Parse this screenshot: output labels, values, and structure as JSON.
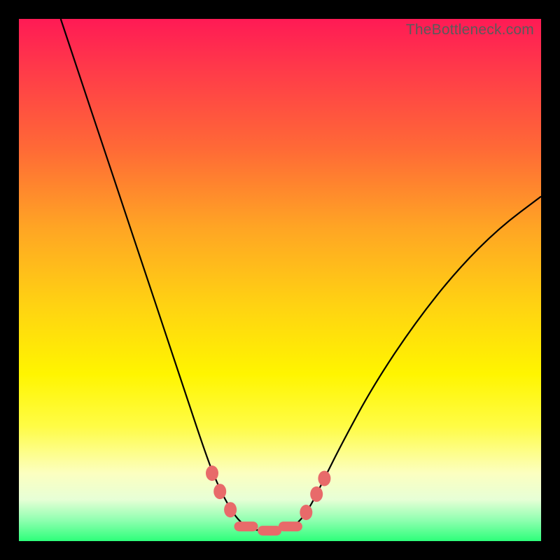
{
  "watermark": "TheBottleneck.com",
  "colors": {
    "frame_bg": "#000000",
    "curve_stroke": "#000000",
    "marker_fill": "#e86a6a",
    "gradient_top": "#ff1a55",
    "gradient_bottom": "#2dff7a"
  },
  "chart_data": {
    "type": "line",
    "title": "",
    "xlabel": "",
    "ylabel": "",
    "xlim": [
      0,
      100
    ],
    "ylim": [
      0,
      100
    ],
    "grid": false,
    "legend": false,
    "annotations": [
      "TheBottleneck.com"
    ],
    "description": "V-shaped bottleneck curve over a vertical red-to-green gradient. Lower y-values (closer to bottom / green) indicate less bottleneck. Minimum plateau near x ≈ 44–52 at y ≈ 2. Pink rounded markers highlight points along the curve near the trough.",
    "series": [
      {
        "name": "bottleneck-curve",
        "x": [
          8,
          12,
          16,
          20,
          24,
          28,
          32,
          36,
          38,
          40,
          42,
          44,
          46,
          48,
          50,
          52,
          54,
          56,
          58,
          62,
          68,
          76,
          84,
          92,
          100
        ],
        "y": [
          100,
          88,
          76,
          64,
          52,
          40,
          28,
          16,
          11,
          7,
          4,
          2.5,
          2,
          2,
          2,
          2.5,
          4,
          7,
          11,
          19,
          30,
          42,
          52,
          60,
          66
        ]
      }
    ],
    "markers": [
      {
        "x": 37.0,
        "y": 13.0,
        "shape": "round"
      },
      {
        "x": 38.5,
        "y": 9.5,
        "shape": "round"
      },
      {
        "x": 40.5,
        "y": 6.0,
        "shape": "round"
      },
      {
        "x": 43.5,
        "y": 2.8,
        "shape": "oblong"
      },
      {
        "x": 48.0,
        "y": 2.0,
        "shape": "oblong"
      },
      {
        "x": 52.0,
        "y": 2.8,
        "shape": "oblong"
      },
      {
        "x": 55.0,
        "y": 5.5,
        "shape": "round"
      },
      {
        "x": 57.0,
        "y": 9.0,
        "shape": "round"
      },
      {
        "x": 58.5,
        "y": 12.0,
        "shape": "round"
      }
    ]
  }
}
